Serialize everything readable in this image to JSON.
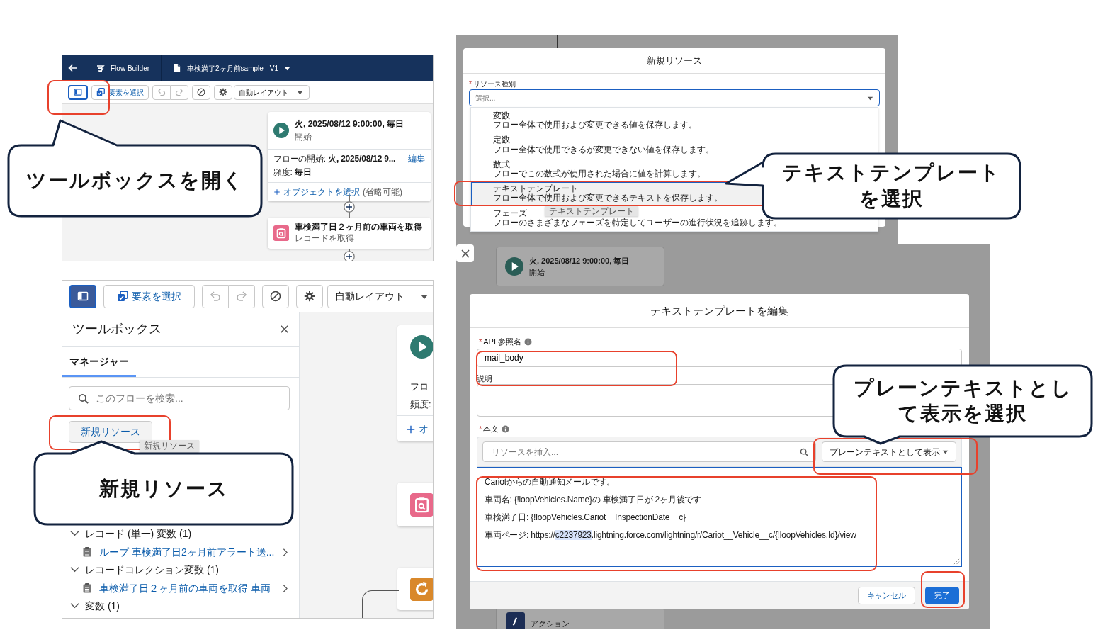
{
  "flow_builder_small": {
    "header": {
      "app_name": "Flow Builder",
      "flow_name": "車検満了2ヶ月前sample - V1"
    },
    "toolbar": {
      "toolbox_toggle_selected": false,
      "select_elements": "要素を選択",
      "layout": "自動レイアウト"
    },
    "start_node": {
      "title": "火, 2025/08/12 9:00:00, 毎日",
      "subtitle": "開始",
      "start_label": "フローの開始:",
      "start_value": "火, 2025/08/12 9...",
      "edit_link": "編集",
      "frequency_label": "頻度:",
      "frequency_value": "毎日",
      "object_link": "オブジェクトを選択",
      "optional": "(省略可能)"
    },
    "get_records_node": {
      "title": "車検満了日２ヶ月前の車両を取得",
      "subtitle": "レコードを取得"
    }
  },
  "flow_builder_toolbox": {
    "toolbar": {
      "toolbox_toggle_selected": true,
      "select_elements": "要素を選択",
      "layout": "自動レイアウト"
    },
    "toolbox": {
      "title": "ツールボックス",
      "tabs": [
        {
          "label": "マネージャー",
          "selected": true
        }
      ],
      "search_placeholder": "このフローを検索...",
      "new_resource_button": "新規リソース",
      "tooltip": "新規リソース",
      "groups": [
        {
          "label": "レコード (単一) 変数 (1)",
          "expanded": true,
          "items": [
            {
              "label": "ループ 車検満了日2ヶ月前アラート送..."
            }
          ]
        },
        {
          "label": "レコードコレクション変数 (1)",
          "expanded": true,
          "items": [
            {
              "label": "車検満了日２ヶ月前の車両を取得 車両"
            }
          ]
        },
        {
          "label": "変数 (1)",
          "expanded": true
        }
      ]
    },
    "canvas_nodes": [
      {
        "kind": "start",
        "lines": [
          "フロ",
          "頻度:"
        ],
        "link": "オ"
      },
      {
        "kind": "get_records"
      },
      {
        "kind": "loop"
      }
    ]
  },
  "new_resource_dialog": {
    "title": "新規リソース",
    "required_mark": "*",
    "field_label": "リソース種別",
    "placeholder": "選択...",
    "options": [
      {
        "title": "変数",
        "description": "フロー全体で使用および変更できる値を保存します。",
        "selected": false
      },
      {
        "title": "定数",
        "description": "フロー全体で使用できるが変更できない値を保存します。",
        "selected": false
      },
      {
        "title": "数式",
        "description": "フローでこの数式が使用された場合に値を計算します。",
        "selected": false
      },
      {
        "title": "テキストテンプレート",
        "description": "フロー全体で使用および変更できるテキストを保存します。",
        "selected": true
      },
      {
        "title": "フェーズ",
        "description": "フローのさまざまなフェーズを特定してユーザーの進行状況を追跡します。",
        "selected": false
      }
    ],
    "tooltip": "テキストテンプレート"
  },
  "edit_template_dialog": {
    "background_node": {
      "title": "火, 2025/08/12 9:00:00, 毎日",
      "subtitle": "開始"
    },
    "action_node": {
      "subtitle": "アクション"
    },
    "title": "テキストテンプレートを編集",
    "api_name_required_mark": "*",
    "api_name_label": "API 参照名",
    "api_name_value": "mail_body",
    "description_label": "説明",
    "body_required_mark": "*",
    "body_label": "本文",
    "resource_placeholder": "リソースを挿入...",
    "display_mode": "プレーンテキストとして表示",
    "body_lines": [
      {
        "text": "Cariotからの自動通知メールです。"
      },
      {
        "text": "車両名: {!loopVehicles.Name}の 車検満了日が 2ヶ月後です"
      },
      {
        "text": "車検満了日: {!loopVehicles.Cariot__InspectionDate__c}"
      },
      {
        "text": "車両ページ: https://",
        "selection": "c2237923",
        "rest": ".lightning.force.com/lightning/r/Cariot__Vehicle__c/{!loopVehicles.Id}/view"
      }
    ],
    "cancel_button": "キャンセル",
    "done_button": "完了"
  },
  "callouts": [
    {
      "lines": [
        "ツールボックスを開く"
      ]
    },
    {
      "lines": [
        "新規リソース"
      ]
    },
    {
      "lines": [
        "テキストテンプレート",
        "を選択"
      ]
    },
    {
      "lines": [
        "プレーンテキストとし",
        "て表示を選択"
      ]
    }
  ]
}
